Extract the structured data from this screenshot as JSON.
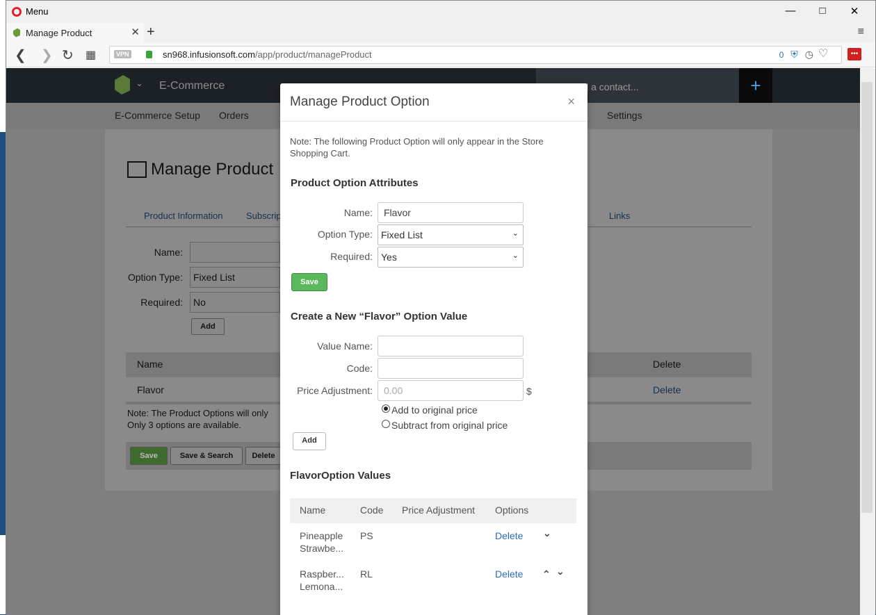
{
  "browser": {
    "menu_label": "Menu",
    "tab_title": "Manage Product",
    "url_host": "sn968.infusionsoft.com",
    "url_path": "/app/product/manageProduct",
    "vpn_label": "VPN",
    "tracker_count": "0"
  },
  "app": {
    "section_title": "E-Commerce",
    "search_placeholder": "Find a contact...",
    "subnav": [
      "E-Commerce Setup",
      "Orders",
      "Settings"
    ]
  },
  "background": {
    "page_title": "Manage Product",
    "tabs": [
      "Product Information",
      "Subscrip",
      "Links"
    ],
    "name_label": "Name:",
    "option_type_label": "Option Type:",
    "option_type_value": "Fixed List",
    "required_label": "Required:",
    "required_value": "No",
    "add_label": "Add",
    "table_headers": [
      "Name",
      "Delete"
    ],
    "row_name": "Flavor",
    "row_delete": "Delete",
    "note_line1": "Note: The Product Options will only",
    "note_line2": "Only 3 options are available.",
    "save_label": "Save",
    "save_search_label": "Save & Search",
    "delete_label": "Delete"
  },
  "modal": {
    "title": "Manage Product Option",
    "close": "×",
    "note": "Note: The following Product Option will only appear in the Store Shopping Cart.",
    "attributes_heading": "Product Option Attributes",
    "name_label": "Name:",
    "name_value": "Flavor",
    "option_type_label": "Option Type:",
    "option_type_value": "Fixed List",
    "required_label": "Required:",
    "required_value": "Yes",
    "save_label": "Save",
    "create_heading": "Create a New “Flavor” Option Value",
    "value_name_label": "Value Name:",
    "code_label": "Code:",
    "price_adj_label": "Price Adjustment:",
    "price_placeholder": "0.00",
    "currency": "$",
    "radio_add": "Add to original price",
    "radio_subtract": "Subtract from original price",
    "add_label": "Add",
    "values_heading": "FlavorOption Values",
    "values_headers": [
      "Name",
      "Code",
      "Price Adjustment",
      "Options"
    ],
    "values_rows": [
      {
        "name1": "Pineapple",
        "name2": "Strawbe...",
        "code": "PS",
        "action": "Delete"
      },
      {
        "name1": "Raspber...",
        "name2": "Lemona...",
        "code": "RL",
        "action": "Delete"
      }
    ]
  }
}
